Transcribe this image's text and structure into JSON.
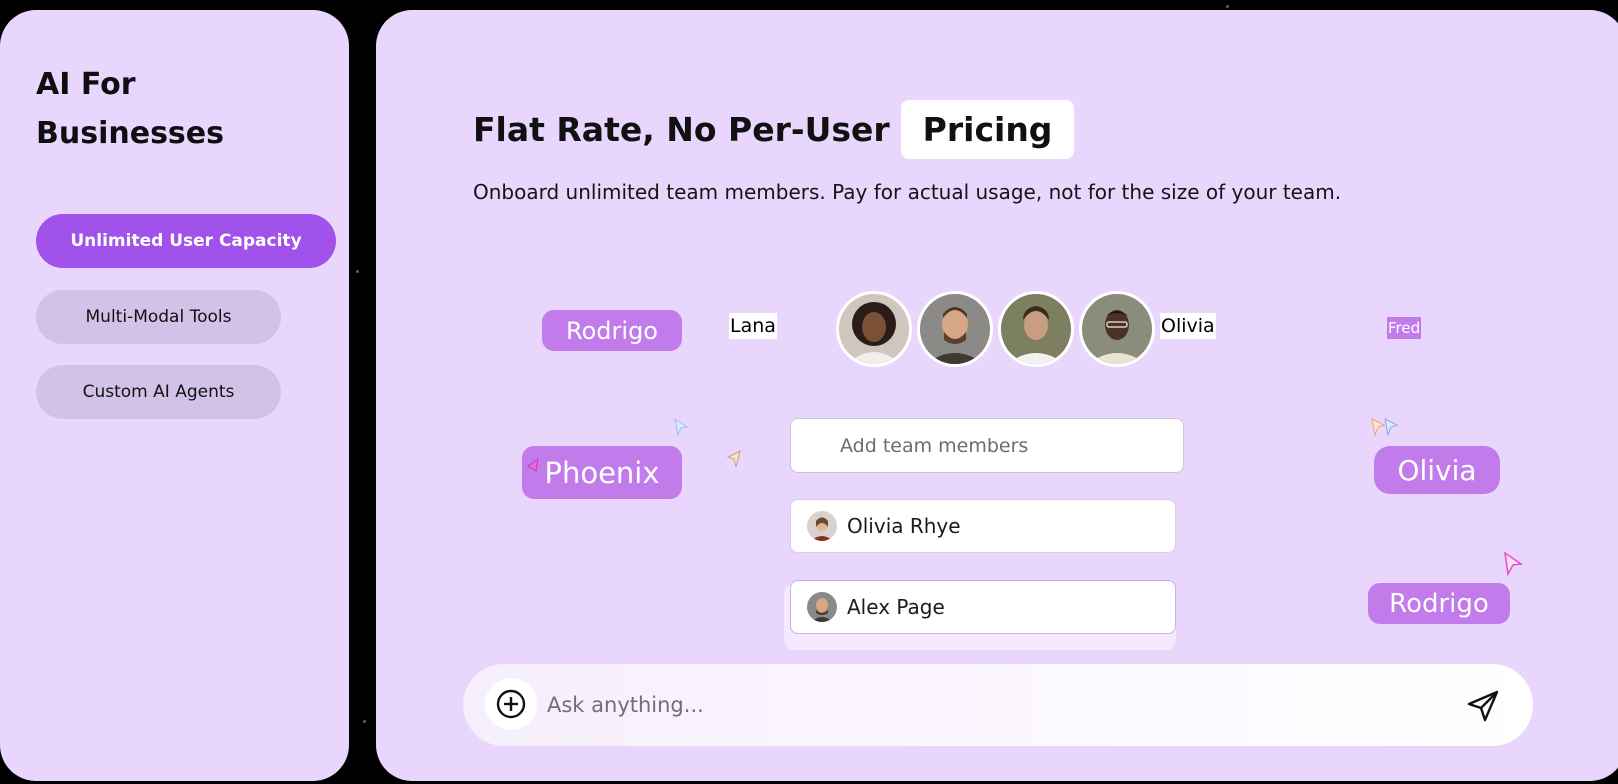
{
  "sidebar": {
    "brand": "AI For Businesses",
    "items": [
      {
        "label": "Unlimited User Capacity",
        "active": true
      },
      {
        "label": "Multi-Modal Tools",
        "active": false
      },
      {
        "label": "Custom AI Agents",
        "active": false
      }
    ]
  },
  "main": {
    "headline": "Flat Rate, No Per-User",
    "badge": "Pricing",
    "subhead": "Onboard unlimited team members. Pay for actual usage, not for the size of your team."
  },
  "names": {
    "rodrigo_top": "Rodrigo",
    "lana": "Lana",
    "olivia_small": "Olivia",
    "fred": "Fred",
    "phoenix": "Phoenix",
    "olivia_pill": "Olivia",
    "rodrigo_bottom": "Rodrigo"
  },
  "team": {
    "add_placeholder": "Add team members",
    "members": [
      {
        "name": "Olivia Rhye"
      },
      {
        "name": "Alex Page"
      }
    ]
  },
  "chat": {
    "placeholder": "Ask anything..."
  },
  "colors": {
    "panel": "#e8d6fd",
    "accent": "#a152ea",
    "name_pill": "#c27bea",
    "inactive_pill": "#d3c2e8"
  },
  "icons": {
    "plus": "plus-circle-icon",
    "send": "send-icon",
    "cursor": "cursor-arrow-icon"
  }
}
